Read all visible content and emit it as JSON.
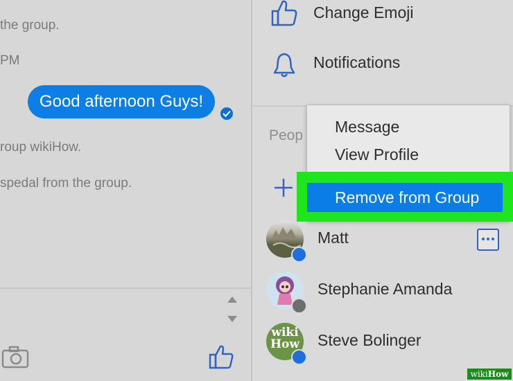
{
  "chat": {
    "system_messages": [
      "the group.",
      "PM",
      "roup wikiHow.",
      "spedal from the group."
    ],
    "outgoing_message": "Good afternoon Guys!"
  },
  "info_panel": {
    "options": [
      {
        "label": "Change Emoji",
        "icon": "thumbs-up-icon"
      },
      {
        "label": "Notifications",
        "icon": "bell-icon"
      }
    ],
    "people_header": "Peop",
    "people": [
      {
        "name": "Matt",
        "badge": "messenger"
      },
      {
        "name": "Stephanie Amanda",
        "badge": "facebook"
      },
      {
        "name": "Steve Bolinger",
        "badge": "messenger"
      }
    ]
  },
  "context_menu": {
    "items": [
      "Message",
      "View Profile",
      "Remove from Group"
    ],
    "highlighted": "Remove from Group"
  },
  "colors": {
    "accent": "#0b7de6",
    "highlight": "#1fe51f",
    "icon_blue": "#2f63c4"
  },
  "avatar_text": {
    "steve_top": "wiki",
    "steve_bottom": "How"
  },
  "watermark": {
    "brand": "wikiHow"
  }
}
